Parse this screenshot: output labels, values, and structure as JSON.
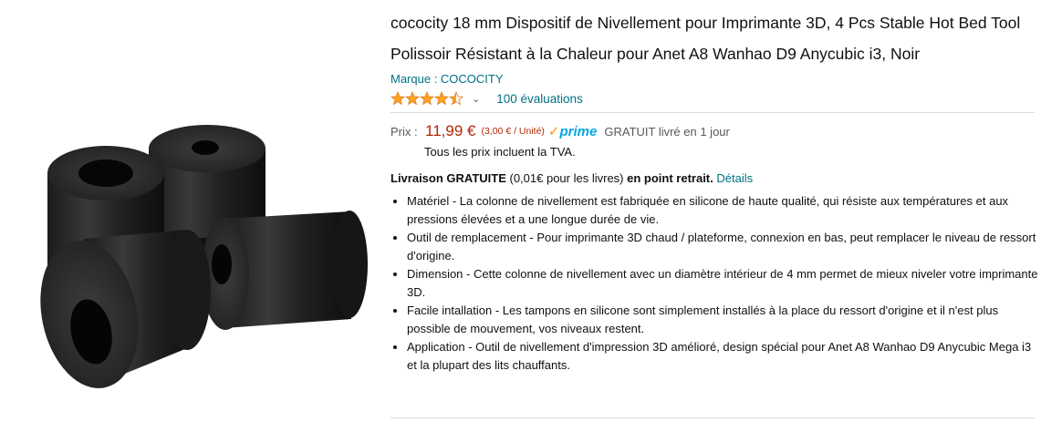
{
  "product": {
    "title": "cococity 18 mm Dispositif de Nivellement pour Imprimante 3D, 4 Pcs Stable Hot Bed Tool Polissoir Résistant à la Chaleur pour Anet A8 Wanhao D9 Anycubic i3, Noir",
    "brand": "Marque : COCOCITY",
    "rating_value": 4.5,
    "reviews": "100 évaluations",
    "price_label": "Prix :",
    "price": "11,99 €",
    "unit_price": "(3,00 € / Unité)",
    "prime_check": "✓",
    "prime_word": "prime",
    "shipping": "GRATUIT livré en 1 jour",
    "vat": "Tous les prix incluent la TVA.",
    "delivery": {
      "bold1": "Livraison GRATUITE",
      "normal1": " (0,01€ pour les livres) ",
      "bold2": "en point retrait.",
      "link": "Détails"
    },
    "bullets": [
      "Matériel - La colonne de nivellement est fabriquée en silicone de haute qualité, qui résiste aux températures et aux pressions élevées et a une longue durée de vie.",
      "Outil de remplacement - Pour imprimante 3D chaud / plateforme, connexion en bas, peut remplacer le niveau de ressort d'origine.",
      "Dimension - Cette colonne de nivellement avec un diamètre intérieur de 4 mm permet de mieux niveler votre imprimante 3D.",
      "Facile intallation - Les tampons en silicone sont simplement installés à la place du ressort d'origine et il n'est plus possible de mouvement, vos niveaux restent.",
      "Application - Outil de nivellement d'impression 3D amélioré, design spécial pour Anet A8 Wanhao D9 Anycubic Mega i3 et la plupart des lits chauffants."
    ]
  },
  "colors": {
    "link": "#007185",
    "price": "#b12704",
    "prime": "#00a8e1",
    "star": "#ffa41c"
  },
  "icons": {
    "chevron": "chevron-down-icon",
    "star": "star-icon"
  }
}
